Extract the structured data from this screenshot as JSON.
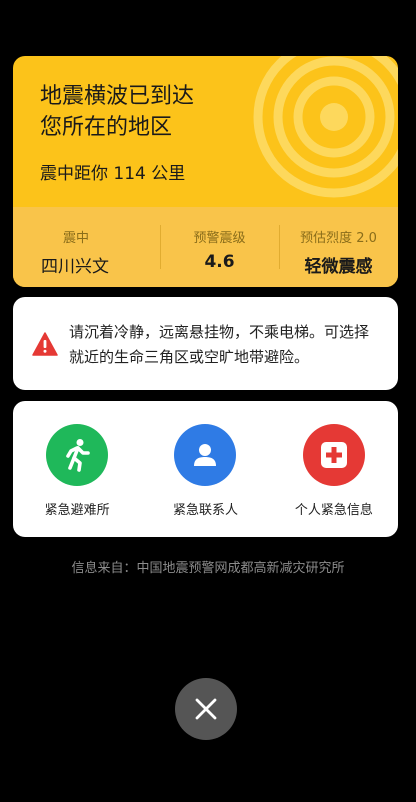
{
  "alert": {
    "headline": "地震横波已到达\n您所在的地区",
    "distance": "震中距你 114 公里",
    "epicenter_label": "震中",
    "epicenter_value": "四川兴文",
    "magnitude_label": "预警震级",
    "magnitude_value": "4.6",
    "intensity_label": "预估烈度 2.0",
    "intensity_value": "轻微震感",
    "accent_color": "#fcc31a"
  },
  "advice": {
    "text": "请沉着冷静，远离悬挂物，不乘电梯。可选择就近的生命三角区或空旷地带避险。",
    "icon": "warning-triangle-icon",
    "icon_color": "#e53935"
  },
  "actions": [
    {
      "label": "紧急避难所",
      "icon": "running-person-icon",
      "color": "#1fb85a"
    },
    {
      "label": "紧急联系人",
      "icon": "person-icon",
      "color": "#2f7be5"
    },
    {
      "label": "个人紧急信息",
      "icon": "medical-cross-icon",
      "color": "#e53935"
    }
  ],
  "source": "信息来自：中国地震预警网成都高新减灾研究所",
  "close": {
    "icon": "close-icon"
  }
}
